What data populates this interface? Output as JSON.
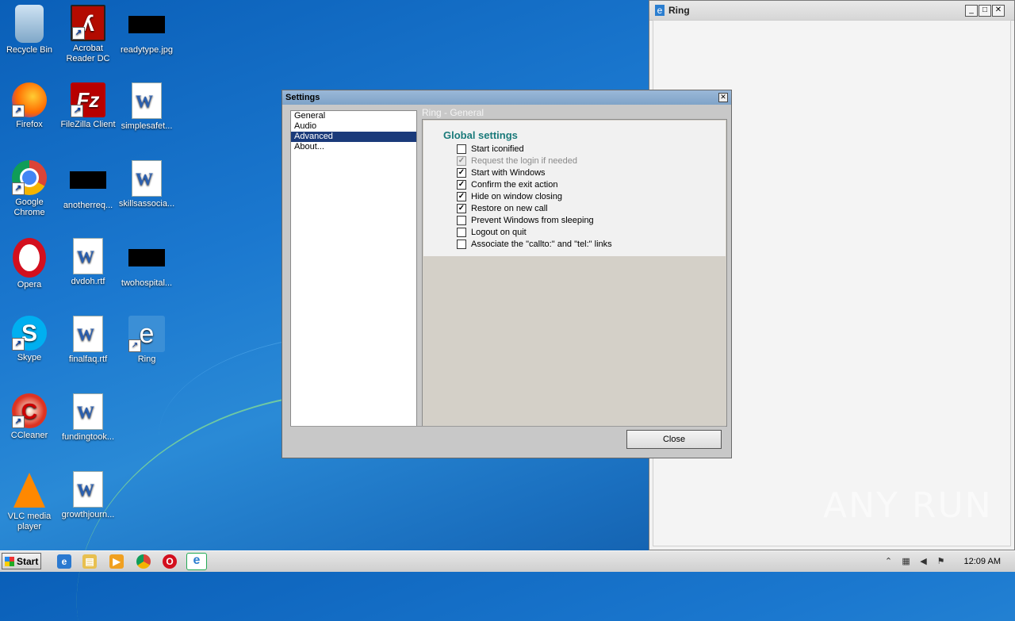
{
  "desktop": {
    "icons": [
      {
        "label": "Recycle Bin"
      },
      {
        "label": "Acrobat Reader DC"
      },
      {
        "label": "readytype.jpg"
      },
      {
        "label": "Firefox"
      },
      {
        "label": "FileZilla Client"
      },
      {
        "label": "simplesafet..."
      },
      {
        "label": "Google Chrome"
      },
      {
        "label": "anotherreq..."
      },
      {
        "label": "skillsassocia..."
      },
      {
        "label": "Opera"
      },
      {
        "label": "dvdoh.rtf"
      },
      {
        "label": "twohospital..."
      },
      {
        "label": "Skype"
      },
      {
        "label": "finalfaq.rtf"
      },
      {
        "label": "Ring"
      },
      {
        "label": "CCleaner"
      },
      {
        "label": "fundingtook..."
      },
      {
        "label": "VLC media player"
      },
      {
        "label": "growthjourn..."
      }
    ]
  },
  "ring_window": {
    "title": "Ring",
    "min": "_",
    "max": "□",
    "close": "✕"
  },
  "settings": {
    "title": "Settings",
    "close": "✕",
    "nav": [
      "General",
      "Audio",
      "Advanced",
      "About..."
    ],
    "selected_nav": "Advanced",
    "pane_header": "Ring - General",
    "section_title": "Global settings",
    "options": [
      {
        "label": "Start iconified",
        "checked": false,
        "disabled": false
      },
      {
        "label": "Request the login if needed",
        "checked": true,
        "disabled": true
      },
      {
        "label": "Start with Windows",
        "checked": true,
        "disabled": false
      },
      {
        "label": "Confirm the exit action",
        "checked": true,
        "disabled": false
      },
      {
        "label": "Hide on window closing",
        "checked": true,
        "disabled": false
      },
      {
        "label": "Restore on new call",
        "checked": true,
        "disabled": false
      },
      {
        "label": "Prevent Windows from sleeping",
        "checked": false,
        "disabled": false
      },
      {
        "label": "Logout on quit",
        "checked": false,
        "disabled": false
      },
      {
        "label": "Associate the \"callto:\" and \"tel:\" links",
        "checked": false,
        "disabled": false
      }
    ],
    "close_button": "Close"
  },
  "watermark": "ANY RUN",
  "taskbar": {
    "start_label": "Start",
    "clock": "12:09 AM"
  },
  "colors": {
    "accent_teal": "#1a7a7a",
    "selection": "#1a3a7a",
    "desktop_blue": "#1b78cf"
  }
}
